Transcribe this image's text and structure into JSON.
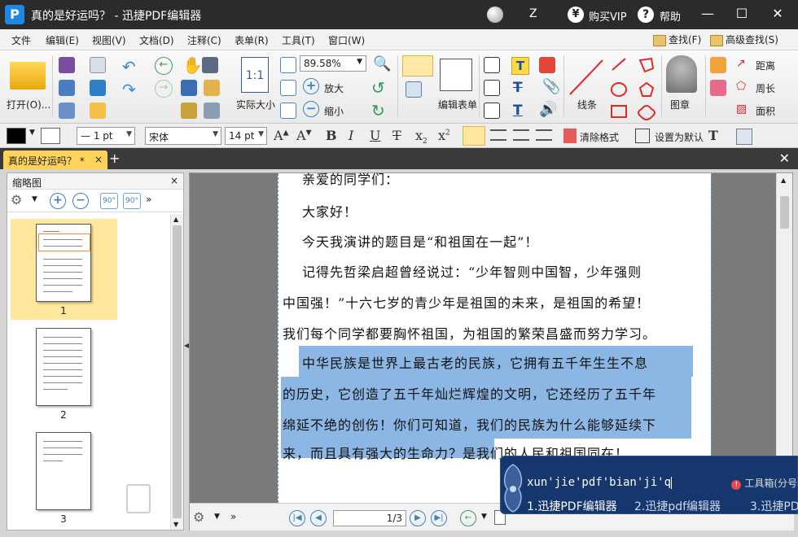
{
  "window": {
    "title": "真的是好运吗？ - 迅捷PDF编辑器",
    "z_label": "Z",
    "buy_vip": "购买VIP",
    "help": "帮助",
    "minimize": "—",
    "maximize": "☐",
    "close": "✕"
  },
  "menu": {
    "items": [
      "文件",
      "编辑(E)",
      "视图(V)",
      "文档(D)",
      "注释(C)",
      "表单(R)",
      "工具(T)",
      "窗口(W)"
    ],
    "find": "查找(F)",
    "advanced_find": "高级查找(S)"
  },
  "toolbar": {
    "open": "打开(O)...",
    "actual_size": "实际大小",
    "zoom_value": "89.58%",
    "zoom_in": "放大",
    "zoom_out": "缩小",
    "edit_form": "编辑表单",
    "line": "线条",
    "stamp": "图章",
    "distance": "距离",
    "perimeter": "周长",
    "area": "面积",
    "icons": {
      "open": "folder-icon",
      "save": "save-icon",
      "print": "print-icon",
      "email": "email-icon",
      "undo": "undo-icon",
      "redo": "redo-icon",
      "hand": "hand-icon",
      "snapshot": "camera-icon",
      "fit": "fit-page-icon",
      "stamp": "stamp-icon"
    }
  },
  "format": {
    "font": "宋体",
    "font_size": "14 pt",
    "line_width": "— 1 pt",
    "clear_format": "清除格式",
    "set_default": "设置为默认",
    "accent_color": "#ffd35a"
  },
  "tabs": {
    "document_tab": "真的是好运吗？ *",
    "close": "×",
    "new_tab": "+",
    "close_all": "✕"
  },
  "thumbnails": {
    "title": "缩略图",
    "close": "×",
    "pages": [
      {
        "number": "1",
        "selected": true
      },
      {
        "number": "2",
        "selected": false
      },
      {
        "number": "3",
        "selected": false
      }
    ]
  },
  "document": {
    "lines": [
      "亲爱的同学们：",
      "大家好！",
      "今天我演讲的题目是“和祖国在一起”！",
      "记得先哲梁启超曾经说过：“少年智则中国智，少年强则",
      "中国强！”十六七岁的青少年是祖国的未来，是祖国的希望！",
      "我们每个同学都要胸怀祖国，为祖国的繁荣昌盛而努力学习。",
      "中华民族是世界上最古老的民族，它拥有五千年生生不息",
      "的历史，它创造了五千年灿烂辉煌的文明，它还经历了五千年",
      "绵延不绝的创伤！你们可知道，我们的民族为什么能够延续下",
      "来，而且具有强大的生命力？是我们的人民和祖国同在！"
    ],
    "selection_color": "#8cb7e4"
  },
  "statusbar": {
    "page_indicator": "1/3"
  },
  "ime": {
    "composition": "xun'jie'pdf'bian'ji'q",
    "toolbox": "工具箱(分号",
    "candidates": [
      "1.迅捷PDF编辑器",
      "2.迅捷pdf编辑器",
      "3.迅捷PD"
    ]
  }
}
